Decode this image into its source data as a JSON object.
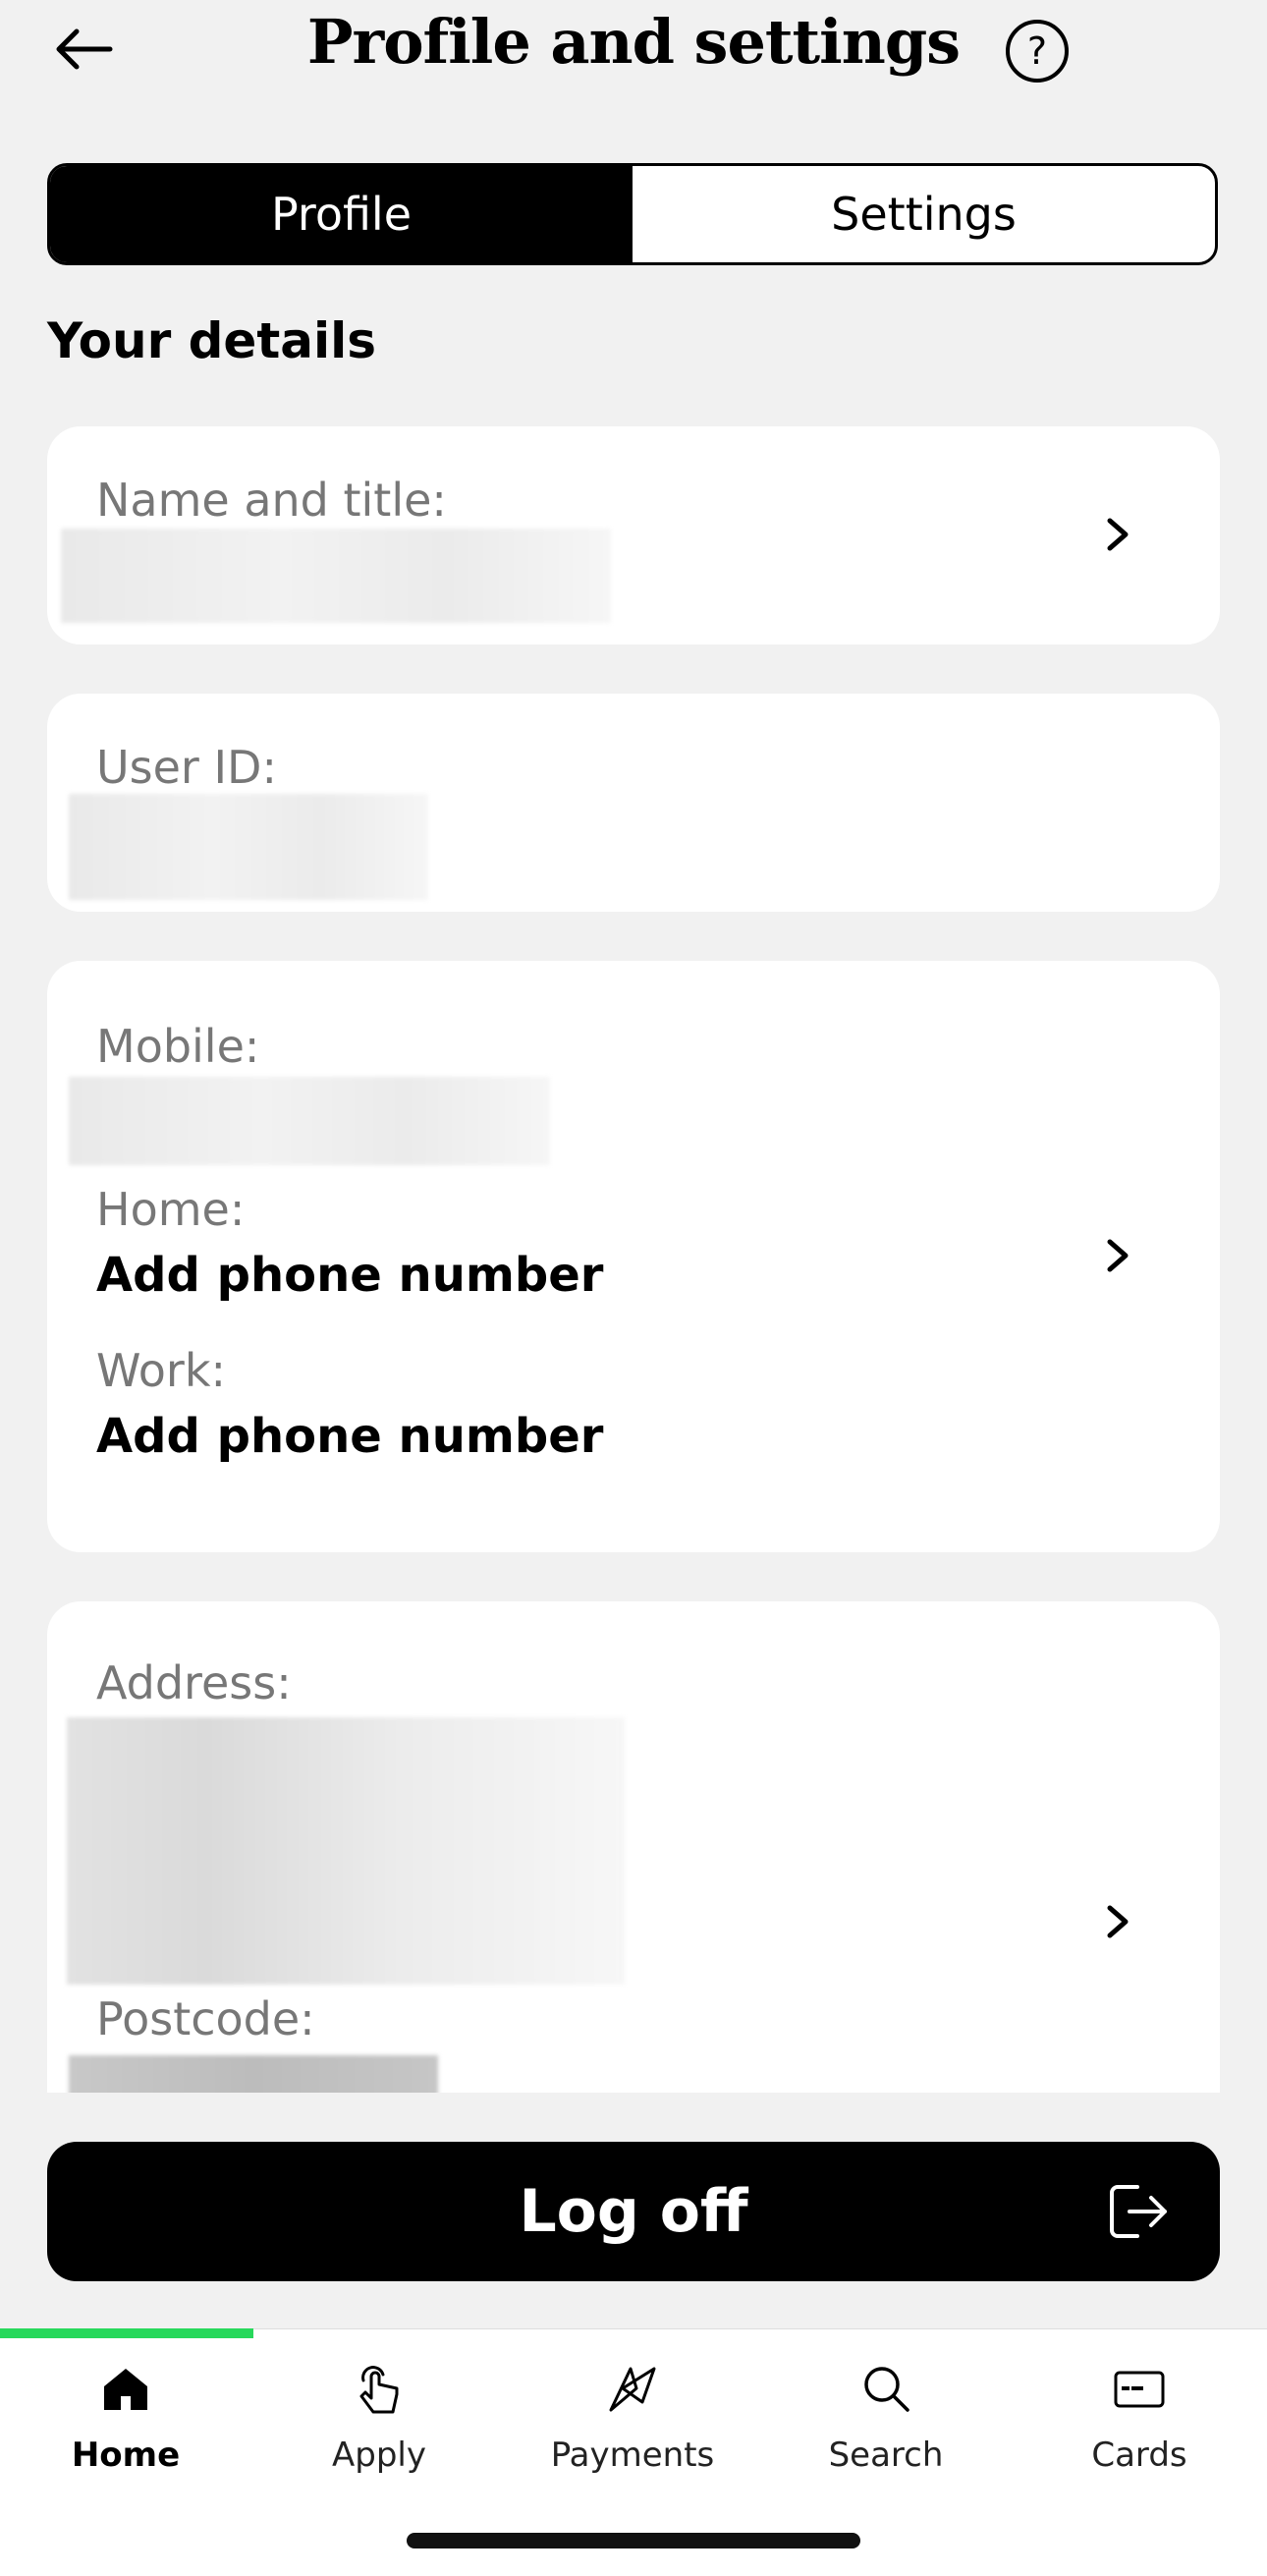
{
  "header": {
    "title": "Profile and settings",
    "back_icon": "arrow-left-icon",
    "help_label": "?"
  },
  "tabs": [
    {
      "label": "Profile",
      "active": true
    },
    {
      "label": "Settings",
      "active": false
    }
  ],
  "section_title": "Your details",
  "cards": {
    "name": {
      "label": "Name and title:"
    },
    "user_id": {
      "label": "User ID:"
    },
    "phones": {
      "mobile_label": "Mobile:",
      "home_label": "Home:",
      "home_value": "Add phone number",
      "work_label": "Work:",
      "work_value": "Add phone number"
    },
    "address": {
      "address_label": "Address:",
      "postcode_label": "Postcode:"
    }
  },
  "logoff": {
    "label": "Log off",
    "icon": "logout-icon"
  },
  "bottom_nav": [
    {
      "label": "Home",
      "icon": "home-icon",
      "active": true
    },
    {
      "label": "Apply",
      "icon": "tap-hand-icon",
      "active": false
    },
    {
      "label": "Payments",
      "icon": "payments-icon",
      "active": false
    },
    {
      "label": "Search",
      "icon": "search-icon",
      "active": false
    },
    {
      "label": "Cards",
      "icon": "card-icon",
      "active": false
    }
  ],
  "colors": {
    "background": "#f1f1f1",
    "accent_green": "#27d85b",
    "primary": "#000000",
    "label_gray": "#777777"
  }
}
